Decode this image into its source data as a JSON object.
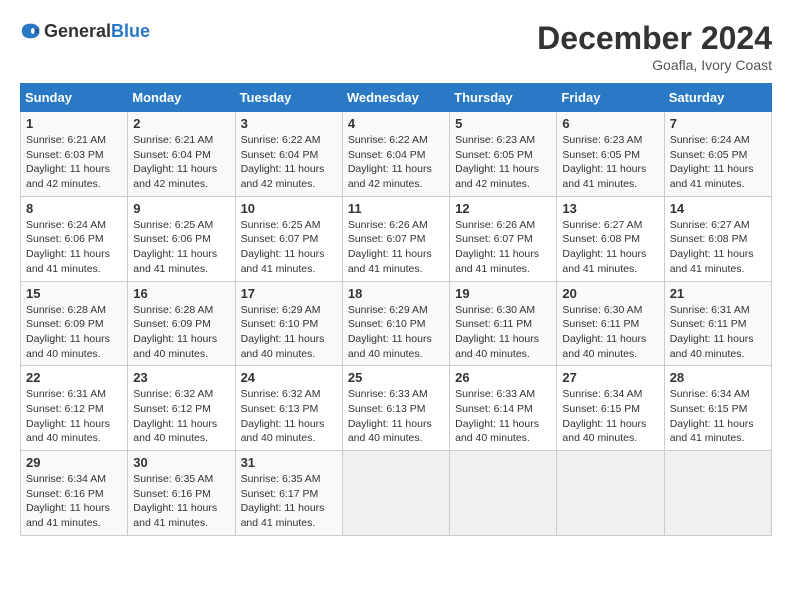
{
  "header": {
    "logo_general": "General",
    "logo_blue": "Blue",
    "month_year": "December 2024",
    "location": "Goafla, Ivory Coast"
  },
  "weekdays": [
    "Sunday",
    "Monday",
    "Tuesday",
    "Wednesday",
    "Thursday",
    "Friday",
    "Saturday"
  ],
  "weeks": [
    [
      {
        "day": "1",
        "info": "Sunrise: 6:21 AM\nSunset: 6:03 PM\nDaylight: 11 hours\nand 42 minutes."
      },
      {
        "day": "2",
        "info": "Sunrise: 6:21 AM\nSunset: 6:04 PM\nDaylight: 11 hours\nand 42 minutes."
      },
      {
        "day": "3",
        "info": "Sunrise: 6:22 AM\nSunset: 6:04 PM\nDaylight: 11 hours\nand 42 minutes."
      },
      {
        "day": "4",
        "info": "Sunrise: 6:22 AM\nSunset: 6:04 PM\nDaylight: 11 hours\nand 42 minutes."
      },
      {
        "day": "5",
        "info": "Sunrise: 6:23 AM\nSunset: 6:05 PM\nDaylight: 11 hours\nand 42 minutes."
      },
      {
        "day": "6",
        "info": "Sunrise: 6:23 AM\nSunset: 6:05 PM\nDaylight: 11 hours\nand 41 minutes."
      },
      {
        "day": "7",
        "info": "Sunrise: 6:24 AM\nSunset: 6:05 PM\nDaylight: 11 hours\nand 41 minutes."
      }
    ],
    [
      {
        "day": "8",
        "info": "Sunrise: 6:24 AM\nSunset: 6:06 PM\nDaylight: 11 hours\nand 41 minutes."
      },
      {
        "day": "9",
        "info": "Sunrise: 6:25 AM\nSunset: 6:06 PM\nDaylight: 11 hours\nand 41 minutes."
      },
      {
        "day": "10",
        "info": "Sunrise: 6:25 AM\nSunset: 6:07 PM\nDaylight: 11 hours\nand 41 minutes."
      },
      {
        "day": "11",
        "info": "Sunrise: 6:26 AM\nSunset: 6:07 PM\nDaylight: 11 hours\nand 41 minutes."
      },
      {
        "day": "12",
        "info": "Sunrise: 6:26 AM\nSunset: 6:07 PM\nDaylight: 11 hours\nand 41 minutes."
      },
      {
        "day": "13",
        "info": "Sunrise: 6:27 AM\nSunset: 6:08 PM\nDaylight: 11 hours\nand 41 minutes."
      },
      {
        "day": "14",
        "info": "Sunrise: 6:27 AM\nSunset: 6:08 PM\nDaylight: 11 hours\nand 41 minutes."
      }
    ],
    [
      {
        "day": "15",
        "info": "Sunrise: 6:28 AM\nSunset: 6:09 PM\nDaylight: 11 hours\nand 40 minutes."
      },
      {
        "day": "16",
        "info": "Sunrise: 6:28 AM\nSunset: 6:09 PM\nDaylight: 11 hours\nand 40 minutes."
      },
      {
        "day": "17",
        "info": "Sunrise: 6:29 AM\nSunset: 6:10 PM\nDaylight: 11 hours\nand 40 minutes."
      },
      {
        "day": "18",
        "info": "Sunrise: 6:29 AM\nSunset: 6:10 PM\nDaylight: 11 hours\nand 40 minutes."
      },
      {
        "day": "19",
        "info": "Sunrise: 6:30 AM\nSunset: 6:11 PM\nDaylight: 11 hours\nand 40 minutes."
      },
      {
        "day": "20",
        "info": "Sunrise: 6:30 AM\nSunset: 6:11 PM\nDaylight: 11 hours\nand 40 minutes."
      },
      {
        "day": "21",
        "info": "Sunrise: 6:31 AM\nSunset: 6:11 PM\nDaylight: 11 hours\nand 40 minutes."
      }
    ],
    [
      {
        "day": "22",
        "info": "Sunrise: 6:31 AM\nSunset: 6:12 PM\nDaylight: 11 hours\nand 40 minutes."
      },
      {
        "day": "23",
        "info": "Sunrise: 6:32 AM\nSunset: 6:12 PM\nDaylight: 11 hours\nand 40 minutes."
      },
      {
        "day": "24",
        "info": "Sunrise: 6:32 AM\nSunset: 6:13 PM\nDaylight: 11 hours\nand 40 minutes."
      },
      {
        "day": "25",
        "info": "Sunrise: 6:33 AM\nSunset: 6:13 PM\nDaylight: 11 hours\nand 40 minutes."
      },
      {
        "day": "26",
        "info": "Sunrise: 6:33 AM\nSunset: 6:14 PM\nDaylight: 11 hours\nand 40 minutes."
      },
      {
        "day": "27",
        "info": "Sunrise: 6:34 AM\nSunset: 6:15 PM\nDaylight: 11 hours\nand 40 minutes."
      },
      {
        "day": "28",
        "info": "Sunrise: 6:34 AM\nSunset: 6:15 PM\nDaylight: 11 hours\nand 41 minutes."
      }
    ],
    [
      {
        "day": "29",
        "info": "Sunrise: 6:34 AM\nSunset: 6:16 PM\nDaylight: 11 hours\nand 41 minutes."
      },
      {
        "day": "30",
        "info": "Sunrise: 6:35 AM\nSunset: 6:16 PM\nDaylight: 11 hours\nand 41 minutes."
      },
      {
        "day": "31",
        "info": "Sunrise: 6:35 AM\nSunset: 6:17 PM\nDaylight: 11 hours\nand 41 minutes."
      },
      {
        "day": "",
        "info": ""
      },
      {
        "day": "",
        "info": ""
      },
      {
        "day": "",
        "info": ""
      },
      {
        "day": "",
        "info": ""
      }
    ]
  ]
}
